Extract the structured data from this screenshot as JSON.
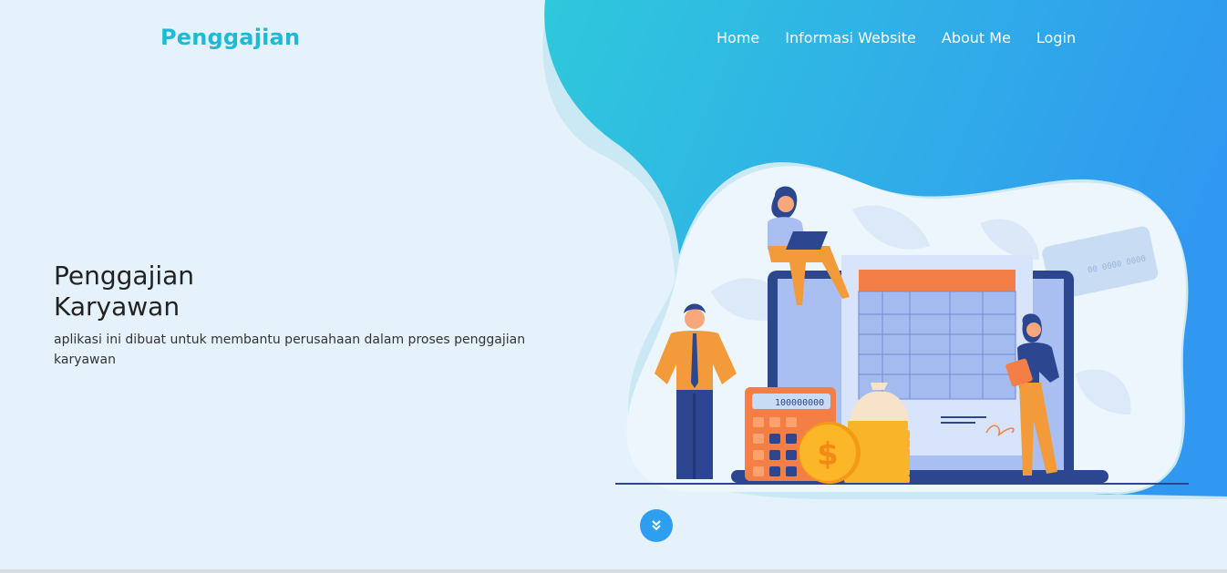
{
  "navbar": {
    "brand": "Penggajian",
    "links": [
      {
        "label": "Home"
      },
      {
        "label": "Informasi Website"
      },
      {
        "label": "About Me"
      },
      {
        "label": "Login"
      }
    ]
  },
  "hero": {
    "title_line1": "Penggajian",
    "title_line2": "Karyawan",
    "description": "aplikasi ini dibuat untuk membantu perusahaan dalam proses penggajian karyawan"
  },
  "illustration": {
    "calculator_display": "100000000",
    "card_number": "00 0000 0000",
    "icons": [
      "calculator-icon",
      "coin-dollar-icon",
      "money-bag-icon",
      "clipboard-icon",
      "laptop-icon"
    ]
  },
  "scroll_button": {
    "icon": "double-chevron-down-icon"
  },
  "colors": {
    "background": "#e6f2fb",
    "brand": "#20b9d3",
    "blob_start": "#2fc8dc",
    "blob_end": "#3098f0",
    "accent_orange": "#f39a3b",
    "accent_navy": "#2d4690"
  }
}
